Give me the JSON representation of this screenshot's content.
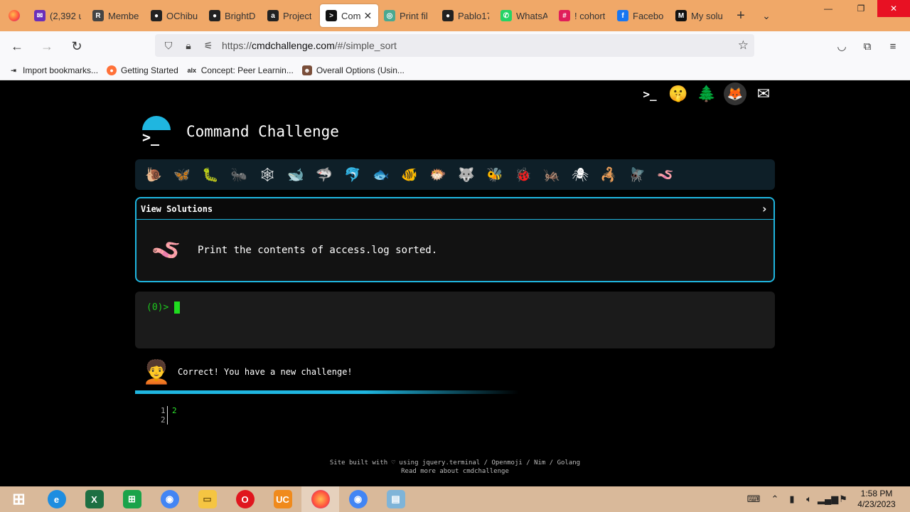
{
  "browser": {
    "tabs": [
      {
        "label": "(2,392 u",
        "icon": "mail-icon",
        "color": "#6b2fb8",
        "glyph": "✉"
      },
      {
        "label": "Membe",
        "icon": "r-icon",
        "color": "#444444",
        "glyph": "R"
      },
      {
        "label": "OChibu",
        "icon": "github-icon",
        "color": "#222222",
        "glyph": "●"
      },
      {
        "label": "BrightD",
        "icon": "github-icon",
        "color": "#222222",
        "glyph": "●"
      },
      {
        "label": "Project",
        "icon": "alx-icon",
        "color": "#222222",
        "glyph": "a"
      },
      {
        "label": "Com",
        "icon": "terminal-icon",
        "color": "#111111",
        "glyph": ">",
        "active": true
      },
      {
        "label": "Print fil",
        "icon": "chatgpt-icon",
        "color": "#4aa890",
        "glyph": "◎"
      },
      {
        "label": "Pablo17",
        "icon": "github-icon",
        "color": "#222222",
        "glyph": "●"
      },
      {
        "label": "WhatsA",
        "icon": "whatsapp-icon",
        "color": "#25d366",
        "glyph": "✆"
      },
      {
        "label": "! cohort",
        "icon": "slack-icon",
        "color": "#e01e5a",
        "glyph": "#"
      },
      {
        "label": "Facebo",
        "icon": "facebook-icon",
        "color": "#1877f2",
        "glyph": "f"
      },
      {
        "label": "My solu",
        "icon": "medium-icon",
        "color": "#111111",
        "glyph": "M"
      }
    ],
    "url_prefix": "https://",
    "url_host": "cmdchallenge.com",
    "url_path": "/#/simple_sort",
    "bookmarks": [
      {
        "label": "Import bookmarks...",
        "icon": "import-icon"
      },
      {
        "label": "Getting Started",
        "icon": "firefox-icon"
      },
      {
        "label": "Concept: Peer Learnin...",
        "icon": "alx-icon"
      },
      {
        "label": "Overall Options (Usin...",
        "icon": "options-icon"
      }
    ]
  },
  "site": {
    "title": "Command Challenge",
    "logo_prompt": ">_",
    "top_icons": [
      "terminal-icon",
      "shushing-face-icon",
      "tree-icon",
      "gitlab-icon",
      "mail-icon"
    ],
    "levels": [
      "🐌",
      "🦋",
      "🐛",
      "🐜",
      "🕸",
      "🐋",
      "🦈",
      "🐬",
      "🐟",
      "🐠",
      "🐡",
      "🐺",
      "🐝",
      "🐞",
      "🦗",
      "🕷",
      "🦂",
      "🪰",
      "🪱"
    ],
    "challenge_header": "View Solutions",
    "challenge_text": "Print the contents of access.log sorted.",
    "challenge_emoji": "🪱",
    "prompt": "(0)>",
    "result_emoji": "🧑‍🦱",
    "result_message": "Correct! You have a new challenge!",
    "output_line_numbers": [
      "1",
      "2"
    ],
    "output_lines": [
      "2",
      ""
    ],
    "footer_line1": "Site built with ♡ using jquery.terminal / Openmoji / Nim / Golang",
    "footer_line2": "Read more about cmdchallenge"
  },
  "taskbar": {
    "time": "1:58 PM",
    "date": "4/23/2023"
  }
}
